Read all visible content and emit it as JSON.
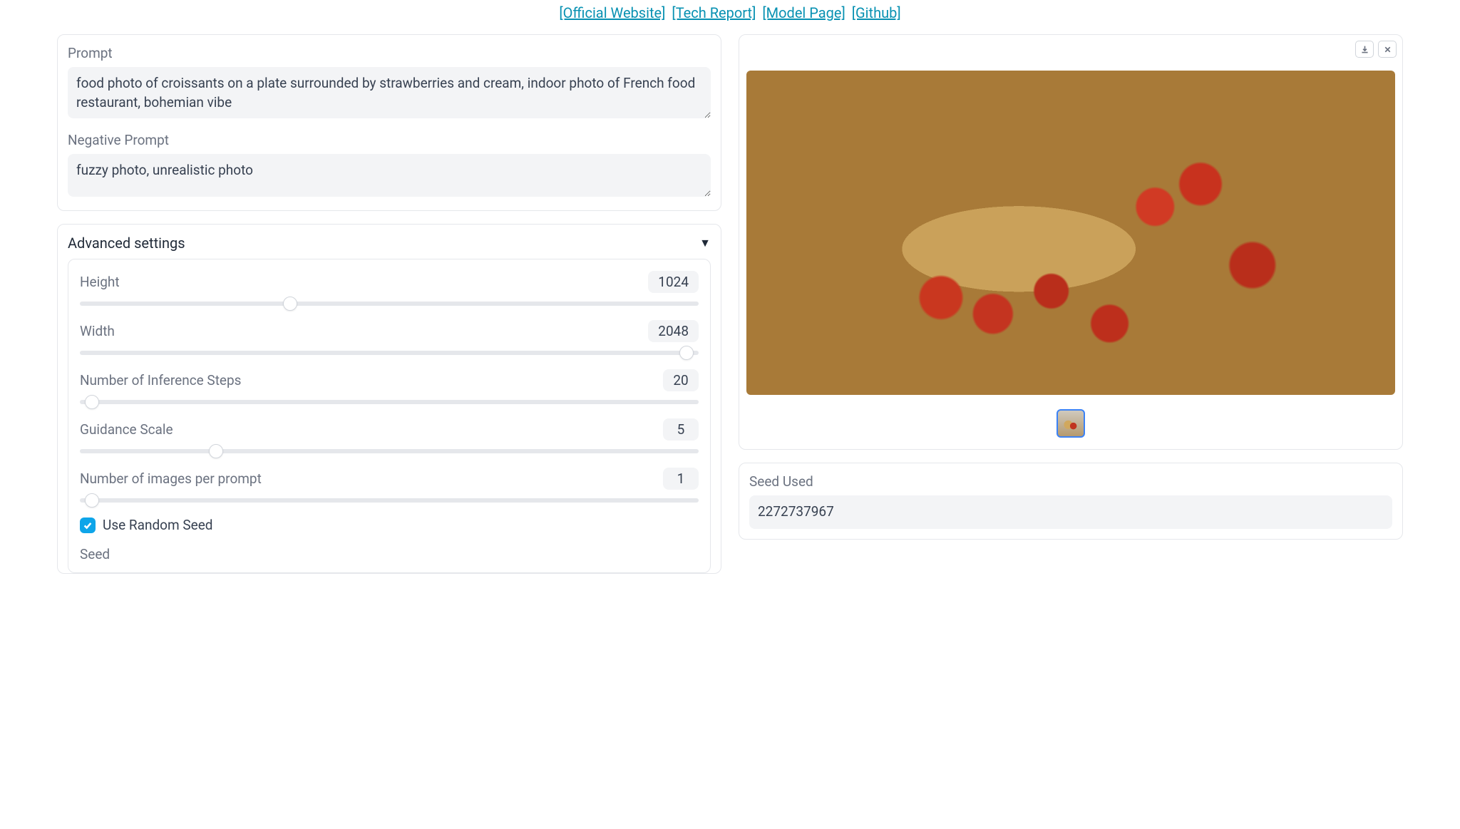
{
  "header": {
    "links": [
      {
        "text": "[Official Website]"
      },
      {
        "text": "[Tech Report]"
      },
      {
        "text": "[Model Page]"
      },
      {
        "text": "[Github]"
      }
    ]
  },
  "prompt": {
    "label": "Prompt",
    "value": "food photo of croissants on a plate surrounded by strawberries and cream, indoor photo of French food restaurant, bohemian vibe"
  },
  "negative_prompt": {
    "label": "Negative Prompt",
    "value": "fuzzy photo, unrealistic photo"
  },
  "advanced": {
    "title": "Advanced settings",
    "height": {
      "label": "Height",
      "value": "1024",
      "pct": 34
    },
    "width": {
      "label": "Width",
      "value": "2048",
      "pct": 98
    },
    "steps": {
      "label": "Number of Inference Steps",
      "value": "20",
      "pct": 2
    },
    "guidance": {
      "label": "Guidance Scale",
      "value": "5",
      "pct": 22
    },
    "num_images": {
      "label": "Number of images per prompt",
      "value": "1",
      "pct": 2
    },
    "random_seed": {
      "label": "Use Random Seed",
      "checked": true
    },
    "seed": {
      "label": "Seed"
    }
  },
  "output": {
    "seed_used_label": "Seed Used",
    "seed_used_value": "2272737967"
  }
}
